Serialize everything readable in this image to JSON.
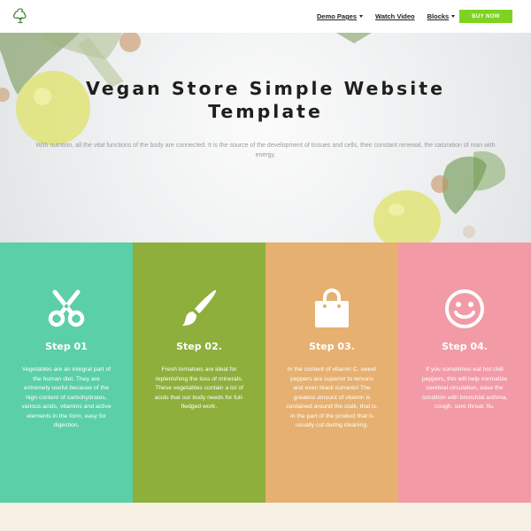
{
  "header": {
    "nav": [
      {
        "label": "Demo Pages",
        "has_caret": true
      },
      {
        "label": "Watch Video",
        "has_caret": false
      },
      {
        "label": "Blocks",
        "has_caret": true
      }
    ],
    "buy_label": "BUY NOW",
    "logo_icon": "broccoli-logo-icon"
  },
  "hero": {
    "title_line1": "Vegan Store Simple Website",
    "title_line2": "Template",
    "subtitle": "With nutrition, all the vital functions of the body are connected. It is the source of the development of tissues and cells, their constant renewal, the saturation of man with energy."
  },
  "steps": [
    {
      "title": "Step 01",
      "text": "Vegetables are an integral part of the human diet. They are extremely useful because of the high content of carbohydrates, various acids, vitamins and active elements in the form, easy for digestion.",
      "color": "#5bcfa8",
      "icon": "scissors-icon"
    },
    {
      "title": "Step 02.",
      "text": "Fresh tomatoes are ideal for replenishing the loss of minerals. These vegetables contain a lot of acids that our body needs for full-fledged work.",
      "color": "#8faf3c",
      "icon": "paintbrush-icon"
    },
    {
      "title": "Step 03.",
      "text": "In the content of vitamin C, sweet peppers are superior to lemons and even black currants! The greatest amount of vitamin is contained around the stalk, that is, in the part of the product that is usually cut during cleaning.",
      "color": "#e6b070",
      "icon": "shopping-bag-icon"
    },
    {
      "title": "Step 04.",
      "text": "If you sometimes eat hot chili peppers, this will help normalize cerebral circulation, ease the condition with bronchial asthma, cough, sore throat, flu.",
      "color": "#f29ba7",
      "icon": "smiley-icon"
    }
  ]
}
